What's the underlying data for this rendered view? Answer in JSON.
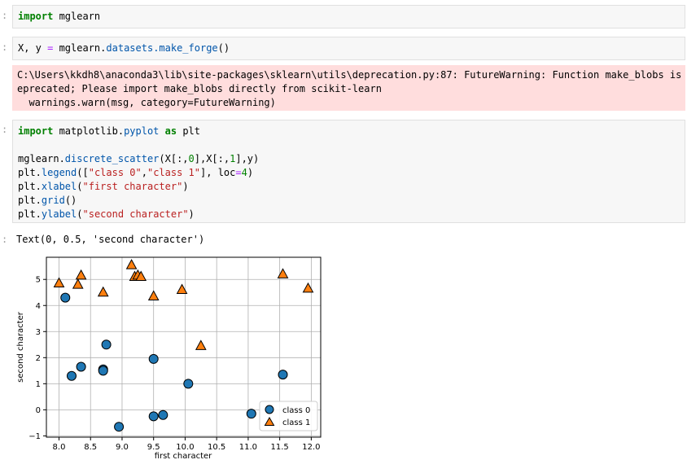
{
  "cells": {
    "c1": {
      "kw": "import",
      "rest": " mglearn"
    },
    "c2": {
      "pre": "X, y ",
      "eq": "=",
      "mid": " mglearn.",
      "fn": "datasets.make_forge",
      "post": "()"
    },
    "warning": {
      "line1": "C:\\Users\\kkdh8\\anaconda3\\lib\\site-packages\\sklearn\\utils\\deprecation.py:87: FutureWarning: Function make_blobs is d",
      "line2": "eprecated; Please import make_blobs directly from scikit-learn",
      "line3": "  warnings.warn(msg, category=FutureWarning)"
    },
    "c3": {
      "l1_kw1": "import",
      "l1_mid": " matplotlib.",
      "l1_fn": "pyplot",
      "l1_kw2": " as",
      "l1_rest": " plt",
      "l2_a": "mglearn.",
      "l2_fn": "discrete_scatter",
      "l2_b": "(X[:,",
      "l2_n1": "0",
      "l2_c": "],X[:,",
      "l2_n2": "1",
      "l2_d": "],y)",
      "l3_a": "plt.",
      "l3_fn": "legend",
      "l3_b": "([",
      "l3_s1": "\"class 0\"",
      "l3_c": ",",
      "l3_s2": "\"class 1\"",
      "l3_d": "], loc",
      "l3_eq": "=",
      "l3_n": "4",
      "l3_e": ")",
      "l4_a": "plt.",
      "l4_fn": "xlabel",
      "l4_b": "(",
      "l4_s": "\"first character\"",
      "l4_c": ")",
      "l5_a": "plt.",
      "l5_fn": "grid",
      "l5_b": "()",
      "l6_a": "plt.",
      "l6_fn": "ylabel",
      "l6_b": "(",
      "l6_s": "\"second character\"",
      "l6_c": ")"
    },
    "output_text": "Text(0, 0.5, 'second character')"
  },
  "chart_data": {
    "type": "scatter",
    "xlabel": "first character",
    "ylabel": "second character",
    "xlim": [
      7.8,
      12.15
    ],
    "ylim": [
      -1.05,
      5.85
    ],
    "xticks": [
      "8.0",
      "8.5",
      "9.0",
      "9.5",
      "10.0",
      "10.5",
      "11.0",
      "11.5",
      "12.0"
    ],
    "xtick_values": [
      8.0,
      8.5,
      9.0,
      9.5,
      10.0,
      10.5,
      11.0,
      11.5,
      12.0
    ],
    "yticks": [
      "−1",
      "0",
      "1",
      "2",
      "3",
      "4",
      "5"
    ],
    "ytick_values": [
      -1,
      0,
      1,
      2,
      3,
      4,
      5
    ],
    "grid": true,
    "legend_position": "lower-right",
    "series": [
      {
        "name": "class 0",
        "marker": "circle",
        "color": "#1f77b4",
        "x": [
          8.1,
          8.2,
          8.35,
          8.7,
          8.7,
          8.75,
          8.95,
          9.5,
          9.5,
          9.65,
          10.05,
          11.05,
          11.55
        ],
        "y": [
          4.3,
          1.3,
          1.65,
          1.55,
          1.5,
          2.5,
          -0.65,
          1.95,
          -0.25,
          -0.2,
          1.0,
          -0.15,
          1.35
        ]
      },
      {
        "name": "class 1",
        "marker": "triangle",
        "color": "#ff7f0e",
        "x": [
          8.0,
          8.3,
          8.35,
          8.7,
          9.15,
          9.2,
          9.25,
          9.3,
          9.5,
          9.95,
          10.25,
          11.55,
          11.95
        ],
        "y": [
          4.85,
          4.8,
          5.15,
          4.5,
          5.55,
          5.1,
          5.15,
          5.1,
          4.35,
          4.6,
          2.45,
          5.2,
          4.65
        ]
      }
    ]
  }
}
